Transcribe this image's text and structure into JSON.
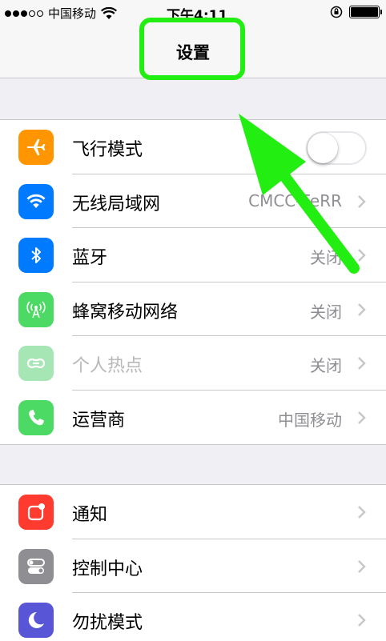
{
  "status_bar": {
    "carrier": "中国移动",
    "time": "下午4:11"
  },
  "nav": {
    "title": "设置"
  },
  "colors": {
    "highlight": "#22ee11",
    "airplane": "#ff9500",
    "wifi": "#007aff",
    "bluetooth": "#007aff",
    "cellular": "#4cd964",
    "hotspot": "#a6e5b4",
    "carrier": "#4cd964",
    "notifications": "#ff3b30",
    "control_center": "#8e8e93",
    "dnd": "#5856d6"
  },
  "group1": [
    {
      "label": "飞行模式",
      "icon": "airplane-icon",
      "toggle": false
    },
    {
      "label": "无线局域网",
      "icon": "wifi-icon",
      "value": "CMCC-FeRR"
    },
    {
      "label": "蓝牙",
      "icon": "bluetooth-icon",
      "value": "关闭"
    },
    {
      "label": "蜂窝移动网络",
      "icon": "cellular-antenna-icon",
      "value": "关闭"
    },
    {
      "label": "个人热点",
      "icon": "hotspot-icon",
      "value": "关闭",
      "disabled": true
    },
    {
      "label": "运营商",
      "icon": "phone-icon",
      "value": "中国移动"
    }
  ],
  "group2": [
    {
      "label": "通知",
      "icon": "notifications-icon"
    },
    {
      "label": "控制中心",
      "icon": "control-center-icon"
    },
    {
      "label": "勿扰模式",
      "icon": "moon-icon"
    }
  ]
}
